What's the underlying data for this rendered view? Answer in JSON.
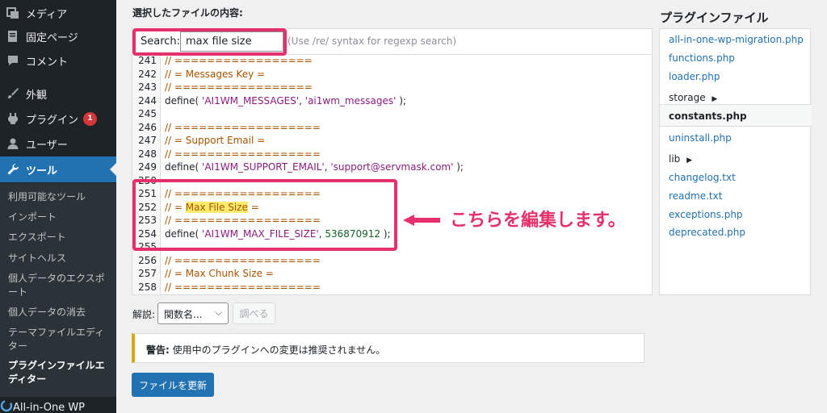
{
  "sidebar": {
    "items": [
      {
        "label": "メディア",
        "icon": "media-icon"
      },
      {
        "label": "固定ページ",
        "icon": "page-icon"
      },
      {
        "label": "コメント",
        "icon": "comment-icon"
      },
      {
        "label": "外観",
        "icon": "brush-icon"
      },
      {
        "label": "プラグイン",
        "icon": "plugin-icon",
        "badge": "1"
      },
      {
        "label": "ユーザー",
        "icon": "user-icon"
      },
      {
        "label": "ツール",
        "icon": "wrench-icon"
      }
    ],
    "submenu": [
      "利用可能なツール",
      "インポート",
      "エクスポート",
      "サイトヘルス",
      "個人データのエクスポ",
      "ート",
      "個人データの消去",
      "テーマファイルエディ",
      "ター",
      "プラグインファイルエ",
      "ディター"
    ],
    "bottom_label": "All-in-One WP"
  },
  "editor": {
    "section_title": "選択したファイルの内容:",
    "search_label": "Search:",
    "search_value": "max file size",
    "search_hint": "(Use /re/ syntax for regexp search)",
    "lines": [
      {
        "n": "241",
        "code": "// ================="
      },
      {
        "n": "242",
        "code": "// = Messages Key ="
      },
      {
        "n": "243",
        "code": "// ================="
      },
      {
        "n": "244",
        "code": "define( 'AI1WM_MESSAGES', 'ai1wm_messages' );"
      },
      {
        "n": "245",
        "code": ""
      },
      {
        "n": "246",
        "code": "// =================="
      },
      {
        "n": "247",
        "code": "// = Support Email ="
      },
      {
        "n": "248",
        "code": "// =================="
      },
      {
        "n": "249",
        "code": "define( 'AI1WM_SUPPORT_EMAIL', 'support@servmask.com' );"
      },
      {
        "n": "250",
        "code": ""
      },
      {
        "n": "251",
        "code": "// =================="
      },
      {
        "n": "252",
        "code": "// = Max File Size ="
      },
      {
        "n": "253",
        "code": "// =================="
      },
      {
        "n": "254",
        "code": "define( 'AI1WM_MAX_FILE_SIZE', 536870912 );"
      },
      {
        "n": "255",
        "code": ""
      },
      {
        "n": "256",
        "code": "// =================="
      },
      {
        "n": "257",
        "code": "// = Max Chunk Size ="
      },
      {
        "n": "258",
        "code": "// =================="
      }
    ]
  },
  "files": {
    "title": "プラグインファイル",
    "items": [
      "all-in-one-wp-migration.php",
      "functions.php",
      "loader.php",
      "storage",
      "constants.php",
      "uninstall.php",
      "lib",
      "changelog.txt",
      "readme.txt",
      "exceptions.php",
      "deprecated.php"
    ]
  },
  "lookup": {
    "label": "解説:",
    "select_value": "関数名...",
    "button": "調べる"
  },
  "notice": {
    "strong": "警告:",
    "text": " 使用中のプラグインへの変更は推奨されません。"
  },
  "update_button": "ファイルを更新",
  "annotation": "こちらを編集します。",
  "colors": {
    "accent": "#2271b1",
    "annotation": "#e6306b",
    "sidebar": "#1d2327",
    "warning": "#dba617"
  }
}
